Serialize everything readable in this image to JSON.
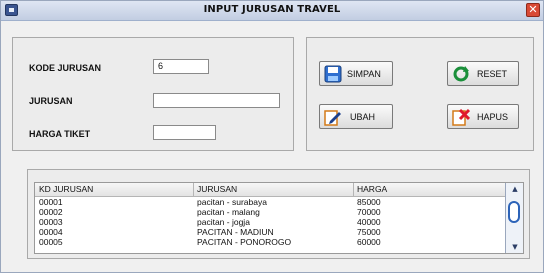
{
  "window": {
    "title": "INPUT JURUSAN TRAVEL",
    "close": "✕"
  },
  "form": {
    "kode_label": "KODE JURUSAN",
    "kode_value": "6",
    "jurusan_label": "JURUSAN",
    "jurusan_value": "",
    "harga_label": "HARGA TIKET",
    "harga_value": ""
  },
  "buttons": {
    "simpan": "SIMPAN",
    "reset": "RESET",
    "ubah": "UBAH",
    "hapus": "HAPUS"
  },
  "table": {
    "headers": [
      "KD JURUSAN",
      "JURUSAN",
      "HARGA"
    ],
    "rows": [
      [
        "00001",
        "pacitan - surabaya",
        "85000"
      ],
      [
        "00002",
        "pacitan - malang",
        "70000"
      ],
      [
        "00003",
        "pacitan - jogja",
        "40000"
      ],
      [
        "00004",
        "PACITAN - MADIUN",
        "75000"
      ],
      [
        "00005",
        "PACITAN - PONOROGO",
        "60000"
      ]
    ]
  },
  "colors": {
    "titlebar": "#c2cde2",
    "close": "#d94a35",
    "scroll_thumb": "#2c63b8"
  }
}
